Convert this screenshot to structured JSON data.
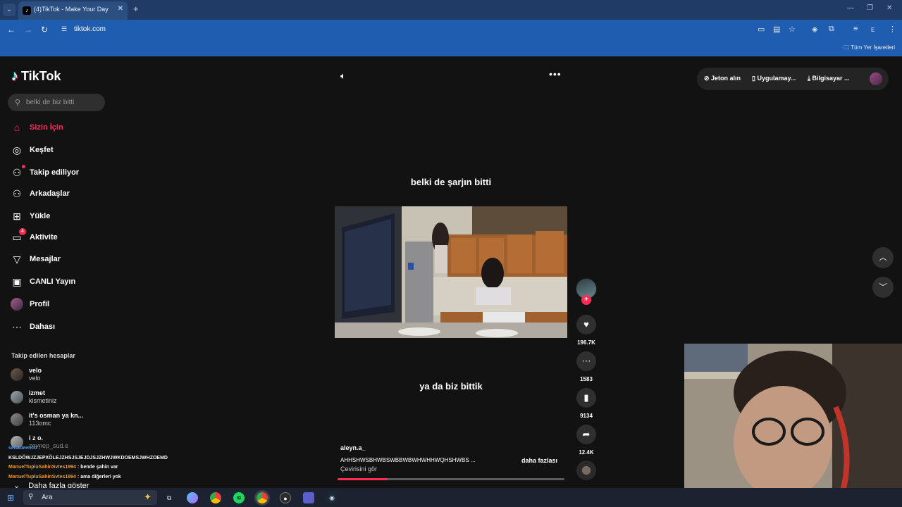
{
  "browser": {
    "tab_title": "(4)TikTok - Make Your Day",
    "tab_favicon": "♪",
    "tab_close": "✕",
    "new_tab": "+",
    "url": "tiktok.com",
    "bookmarks_all": "Tüm Yer İşaretleri",
    "profile_initial": "E"
  },
  "tiktok": {
    "logo_text": "TikTok",
    "search_placeholder": "belki de biz bitti",
    "nav": [
      {
        "label": "Sizin İçin",
        "icon": "home-icon",
        "glyph": "⌂"
      },
      {
        "label": "Keşfet",
        "icon": "compass-icon",
        "glyph": "◎"
      },
      {
        "label": "Takip ediliyor",
        "icon": "following-icon",
        "glyph": "⚇"
      },
      {
        "label": "Arkadaşlar",
        "icon": "friends-icon",
        "glyph": "⚇"
      },
      {
        "label": "Yükle",
        "icon": "upload-icon",
        "glyph": "⊞"
      },
      {
        "label": "Aktivite",
        "icon": "activity-icon",
        "glyph": "▭",
        "badge": "4"
      },
      {
        "label": "Mesajlar",
        "icon": "messages-icon",
        "glyph": "▽"
      },
      {
        "label": "CANLI Yayın",
        "icon": "live-icon",
        "glyph": "▣"
      },
      {
        "label": "Profil",
        "icon": "profile-avatar",
        "glyph": ""
      },
      {
        "label": "Dahası",
        "icon": "more-icon",
        "glyph": "⋯"
      }
    ],
    "following_header": "Takip edilen hesaplar",
    "following": [
      {
        "name": "velo",
        "handle": "velo"
      },
      {
        "name": "izmet",
        "handle": "kismetiniz"
      },
      {
        "name": "it's osman ya kn...",
        "handle": "113omc"
      },
      {
        "name": "i z o.",
        "handle": "zeynep_sud.e"
      }
    ],
    "show_more": "Daha fazla göster",
    "video": {
      "caption_top": "belki de şarjın bitti",
      "caption_bottom": "ya da biz bittik",
      "author": "aleyn.a_",
      "description": "AHHSHWSBHWBSWBBWBWHWHHWQHSHWBS ...",
      "more_link": "daha fazlası",
      "translate": "Çevirisini gör",
      "progress": 0.22
    },
    "actions": {
      "likes": "196.7K",
      "comments": "1583",
      "saves": "9134",
      "shares": "12.4K"
    },
    "top_right": {
      "coins": "Jeton alın",
      "app": "Uygulamay...",
      "desktop": "Bilgisayar ..."
    }
  },
  "chat": [
    {
      "user": "senabeencb",
      "message": "KSLDÖWJZJEPXÖLEJZHSJSJEJDJSJZHWJWKDOEMSJWHZOEMD",
      "color": "#4aa3ff"
    },
    {
      "user": "ManuelTupluSahinSvtes1994",
      "message": "bende şahin var",
      "color": "#f0a030"
    },
    {
      "user": "ManuelTupluSahinSvtes1994",
      "message": "ama diğerleri yok",
      "color": "#f0a030"
    }
  ],
  "taskbar": {
    "search_label": "Ara"
  }
}
